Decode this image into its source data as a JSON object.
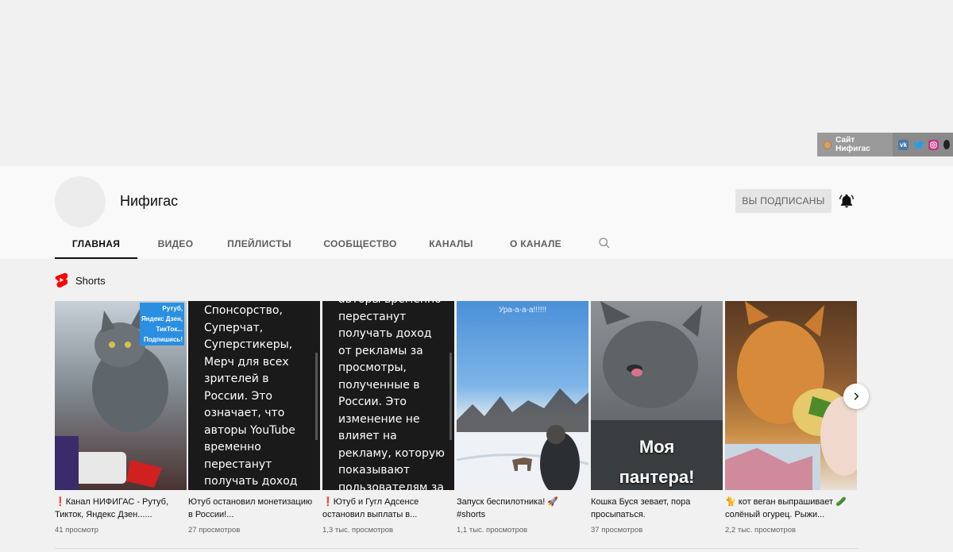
{
  "banner": {
    "site_link": "Сайт Нифигас",
    "social_icons": [
      "vk-icon",
      "twitter-icon",
      "instagram-icon"
    ]
  },
  "channel": {
    "name": "Нифигас",
    "subscribed_label": "ВЫ ПОДПИСАНЫ"
  },
  "tabs": [
    "ГЛАВНАЯ",
    "ВИДЕО",
    "ПЛЕЙЛИСТЫ",
    "СООБЩЕСТВО",
    "КАНАЛЫ",
    "О КАНАЛЕ"
  ],
  "shorts": {
    "title": "Shorts",
    "items": [
      {
        "title": "❗Канал НИФИГАС - Рутуб, Тикток, Яндекс Дзен......",
        "views": "41 просмотр",
        "overlay": "Рутуб,\nЯндекс Дзен,\nТикТок...\nПодпишись!"
      },
      {
        "title": "Ютуб остановил монетизацию в России!...",
        "views": "27 просмотров",
        "overlay": "Спонсорство, Суперчат, Суперстикеры, Мерч для всех зрителей в России. Это означает, что авторы YouTube временно перестанут получать доход от"
      },
      {
        "title": "❗Ютуб и Гугл Адсенсе остановил выплаты в...",
        "views": "1,3 тыс. просмотров",
        "overlay": "авторы временно перестанут получать доход от рекламы за просмотры, полученные в России. Это изменение не влияет на рекламу, которую показывают пользователям за"
      },
      {
        "title": "Запуск беспилотника! 🚀 #shorts",
        "views": "1,1 тыс. просмотров",
        "overlay": "Ура-а-а-а!!!!!!"
      },
      {
        "title": "Кошка Буся зевает, пора просыпаться.",
        "views": "37 просмотров",
        "overlay": "Моя пантера!"
      },
      {
        "title": "🐈 кот веган выпрашивает 🥒 солёный огурец. Рыжи...",
        "views": "2,2 тыс. просмотров",
        "overlay": ""
      }
    ]
  },
  "colors": {
    "shorts_red": "#ff0000",
    "header_bg": "#f9f9f9",
    "page_bg": "#f1f1f1",
    "button_bg": "#e5e5e5"
  }
}
